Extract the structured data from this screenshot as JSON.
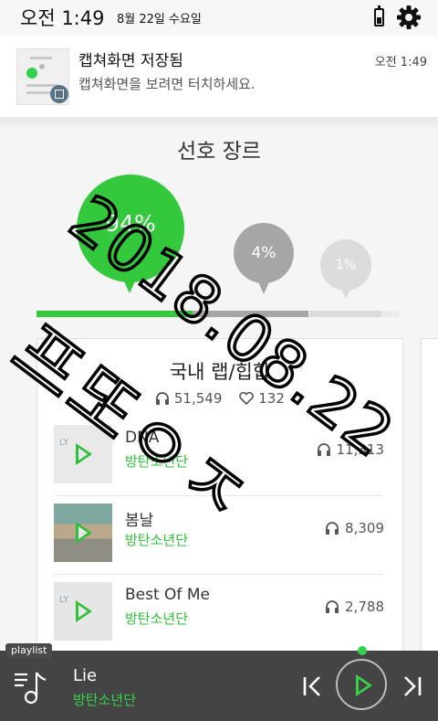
{
  "status_bar": {
    "time": "오전 1:49",
    "date": "8월 22일 수요일"
  },
  "notification": {
    "title": "캡쳐화면 저장됨",
    "time": "오전 1:49",
    "text": "캡쳐화면을 보려면 터치하세요."
  },
  "genre": {
    "title": "선호 장르",
    "bubbles": [
      {
        "label": "94%",
        "value": 94,
        "color": "#34c83c"
      },
      {
        "label": "4%",
        "value": 4,
        "color": "#a6a6a6"
      },
      {
        "label": "1%",
        "value": 1,
        "color": "#dcdcdc"
      }
    ],
    "bar_fractions": [
      0.43,
      0.32,
      0.2
    ]
  },
  "card": {
    "title": "국내 랩/힙합",
    "listens": "51,549",
    "likes": "132",
    "songs": [
      {
        "title": "DNA",
        "artist": "방탄소년단",
        "plays": "11,313"
      },
      {
        "title": "봄날",
        "artist": "방탄소년단",
        "plays": "8,309"
      },
      {
        "title": "Best Of Me",
        "artist": "방탄소년단",
        "plays": "2,788"
      }
    ]
  },
  "player": {
    "tag": "playlist",
    "title": "Lie",
    "artist": "방탄소년단"
  },
  "handwriting": {
    "date": "2018.08.22",
    "word": "프또ㅇㅈ"
  },
  "colors": {
    "accent": "#34c83c",
    "player_bg": "#444444"
  },
  "icons": [
    "battery-icon",
    "gear-icon",
    "headphones-icon",
    "heart-icon",
    "play-icon",
    "playlist-icon",
    "prev-icon",
    "next-icon"
  ]
}
